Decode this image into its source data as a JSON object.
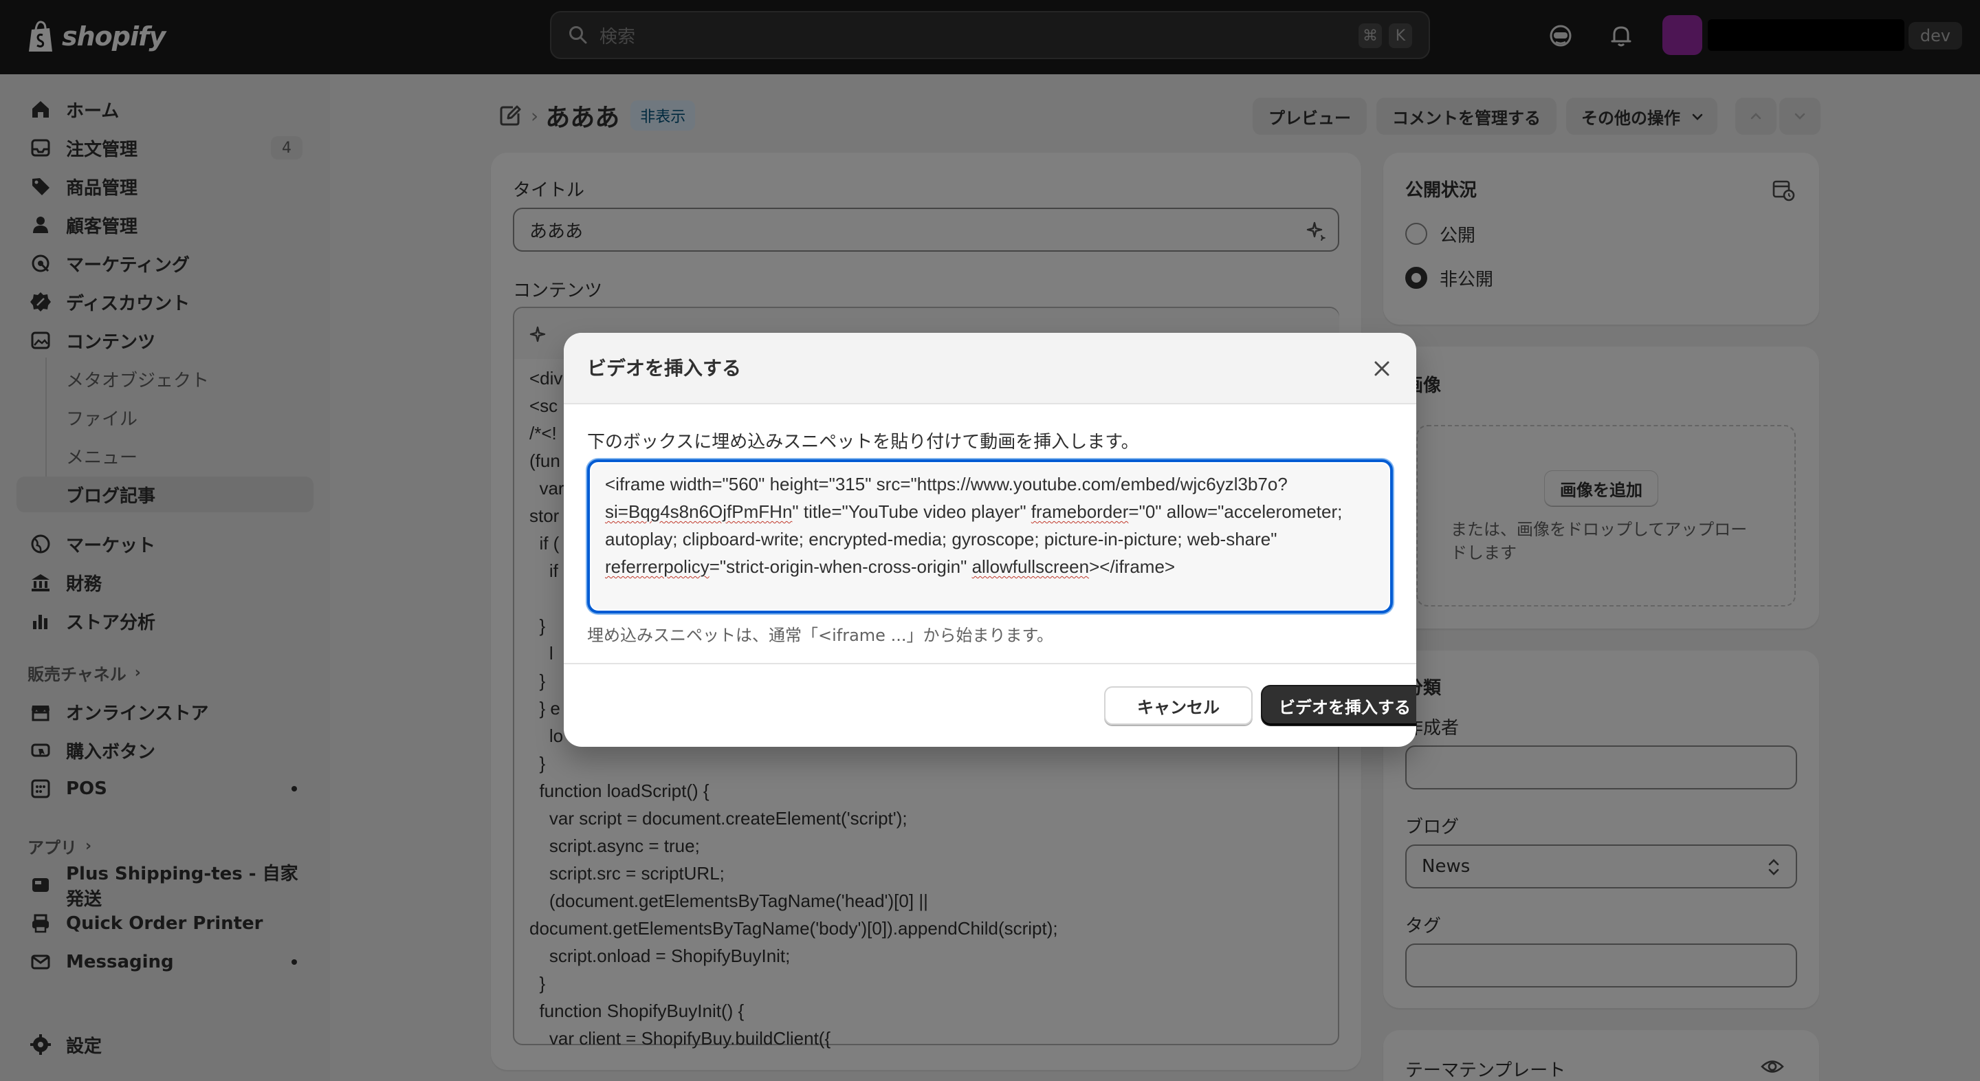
{
  "topbar": {
    "brand": "shopify",
    "search_placeholder": "検索",
    "kbd_cmd": "⌘",
    "kbd_k": "K",
    "dev_label": "dev"
  },
  "sidebar": {
    "items": [
      {
        "label": "ホーム",
        "icon": "home-icon"
      },
      {
        "label": "注文管理",
        "icon": "inbox-icon",
        "count": "4"
      },
      {
        "label": "商品管理",
        "icon": "tag-icon"
      },
      {
        "label": "顧客管理",
        "icon": "person-icon"
      },
      {
        "label": "マーケティング",
        "icon": "target-icon"
      },
      {
        "label": "ディスカウント",
        "icon": "discount-icon"
      },
      {
        "label": "コンテンツ",
        "icon": "image-icon"
      }
    ],
    "content_sub": [
      "メタオブジェクト",
      "ファイル",
      "メニュー",
      "ブログ記事"
    ],
    "items2": [
      {
        "label": "マーケット",
        "icon": "globe-icon"
      },
      {
        "label": "財務",
        "icon": "bank-icon"
      },
      {
        "label": "ストア分析",
        "icon": "chart-icon"
      }
    ],
    "sales_channels_label": "販売チャネル",
    "channels": [
      {
        "label": "オンラインストア",
        "icon": "store-icon"
      },
      {
        "label": "購入ボタン",
        "icon": "buy-button-icon"
      },
      {
        "label": "POS",
        "icon": "pos-icon"
      }
    ],
    "apps_label": "アプリ",
    "apps": [
      {
        "label": "Plus Shipping-tes - 自家発送",
        "icon": "app-icon"
      },
      {
        "label": "Quick Order Printer",
        "icon": "printer-icon"
      },
      {
        "label": "Messaging",
        "icon": "mail-icon"
      }
    ],
    "settings_label": "設定"
  },
  "page": {
    "title": "あああ",
    "status_badge": "非表示",
    "buttons": {
      "preview": "プレビュー",
      "manage_comments": "コメントを管理する",
      "more_actions": "その他の操作"
    }
  },
  "editor": {
    "title_label": "タイトル",
    "title_value": "あああ",
    "content_label": "コンテンツ",
    "code_lines": [
      "<div",
      "<sc",
      "/*<!",
      "(fun",
      "  var",
      "stor",
      "  if (",
      "    if",
      "",
      "  }",
      "    l",
      "  }",
      "  } e",
      "    lo",
      "  }",
      "  function loadScript() {",
      "    var script = document.createElement('script');",
      "    script.async = true;",
      "    script.src = scriptURL;",
      "    (document.getElementsByTagName('head')[0] ||",
      "document.getElementsByTagName('body')[0]).appendChild(script);",
      "    script.onload = ShopifyBuyInit;",
      "  }",
      "  function ShopifyBuyInit() {",
      "    var client = ShopifyBuy.buildClient({"
    ]
  },
  "right": {
    "visibility_title": "公開状況",
    "visibility_options": [
      "公開",
      "非公開"
    ],
    "visibility_selected": "非公開",
    "image_title": "画像",
    "add_image": "画像を追加",
    "drop_hint_1": "または、画像をドロップしてアップロー",
    "drop_hint_2": "ドします",
    "org_title": "分類",
    "author_label": "作成者",
    "blog_label": "ブログ",
    "blog_value": "News",
    "tags_label": "タグ",
    "theme_template_label": "テーマテンプレート"
  },
  "modal": {
    "title": "ビデオを挿入する",
    "description": "下のボックスに埋め込みスニペットを貼り付けて動画を挿入します。",
    "snippet_parts": [
      "<iframe width=\"560\" height=\"315\" src=\"https://www.youtube.com/embed/wjc6yzl3b7o?",
      "si=Bqg4s8n6OjfPmFHn",
      "\" title=\"YouTube video player\" ",
      "frameborder",
      "=\"0\" allow=\"accelerometer; autoplay; clipboard-write; encrypted-media; gyroscope; picture-in-picture; web-share\" ",
      "referrerpolicy",
      "=\"strict-origin-when-cross-origin\" ",
      "allowfullscreen",
      "></iframe>"
    ],
    "help_text": "埋め込みスニペットは、通常「<iframe ...」から始まります。",
    "cancel_label": "キャンセル",
    "submit_label": "ビデオを挿入する"
  },
  "colors": {
    "topbar": "#1a1a1a",
    "primary_button": "#303030",
    "focus_ring": "#005bd3",
    "avatar": "#9b2ba8",
    "status_badge_bg": "#e0f0ff"
  }
}
